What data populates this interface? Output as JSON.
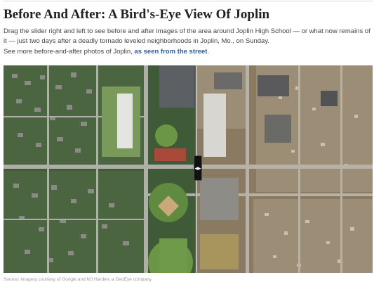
{
  "article": {
    "title": "Before And After: A Bird's-Eye View Of Joplin",
    "intro": "Drag the slider right and left to see before and after images of the area around Joplin High School — or what now remains of it — just two days after a deadly tornado leveled neighborhoods in Joplin, Mo., on Sunday.",
    "see_more_prefix": "See more before-and-after photos of Joplin,",
    "see_more_link": "as seen from the street",
    "see_more_suffix": ".",
    "credit": "Source: Imagery courtesy of Google and MJ Harden, a GeoEye company"
  },
  "slider": {
    "position": 0.52,
    "handle_icon": "left-right-arrows-icon",
    "handle_glyph": "◂▸"
  },
  "colors": {
    "link": "#2c5d9c",
    "before_vegetation": "#3f5a36",
    "before_field": "#5f8a3f",
    "after_debris": "#8a7a62",
    "after_road": "#b8b2a6"
  }
}
